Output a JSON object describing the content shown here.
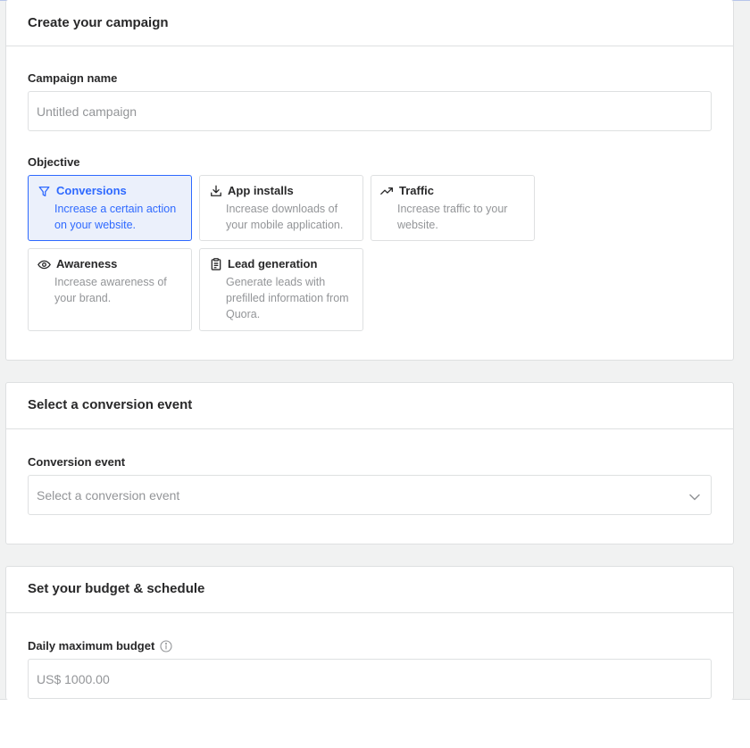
{
  "campaign": {
    "title": "Create your campaign",
    "name_label": "Campaign name",
    "name_placeholder": "Untitled campaign",
    "objective_label": "Objective",
    "objectives": [
      {
        "label": "Conversions",
        "desc": "Increase a certain action on your website.",
        "icon": "filter-icon",
        "selected": true
      },
      {
        "label": "App installs",
        "desc": "Increase downloads of your mobile application.",
        "icon": "download-icon",
        "selected": false
      },
      {
        "label": "Traffic",
        "desc": "Increase traffic to your website.",
        "icon": "trending-up-icon",
        "selected": false
      },
      {
        "label": "Awareness",
        "desc": "Increase awareness of your brand.",
        "icon": "eye-icon",
        "selected": false
      },
      {
        "label": "Lead generation",
        "desc": "Generate leads with prefilled information from Quora.",
        "icon": "clipboard-icon",
        "selected": false
      }
    ]
  },
  "conversion": {
    "title": "Select a conversion event",
    "event_label": "Conversion event",
    "event_placeholder": "Select a conversion event"
  },
  "budget": {
    "title": "Set your budget & schedule",
    "daily_label": "Daily maximum budget",
    "daily_placeholder": "US$ 1000.00"
  },
  "colors": {
    "accent": "#2e69ff",
    "selected_bg": "#ebf0fb",
    "page_bg": "#f1f2f2",
    "border": "#dee0e1",
    "placeholder": "#939598"
  }
}
